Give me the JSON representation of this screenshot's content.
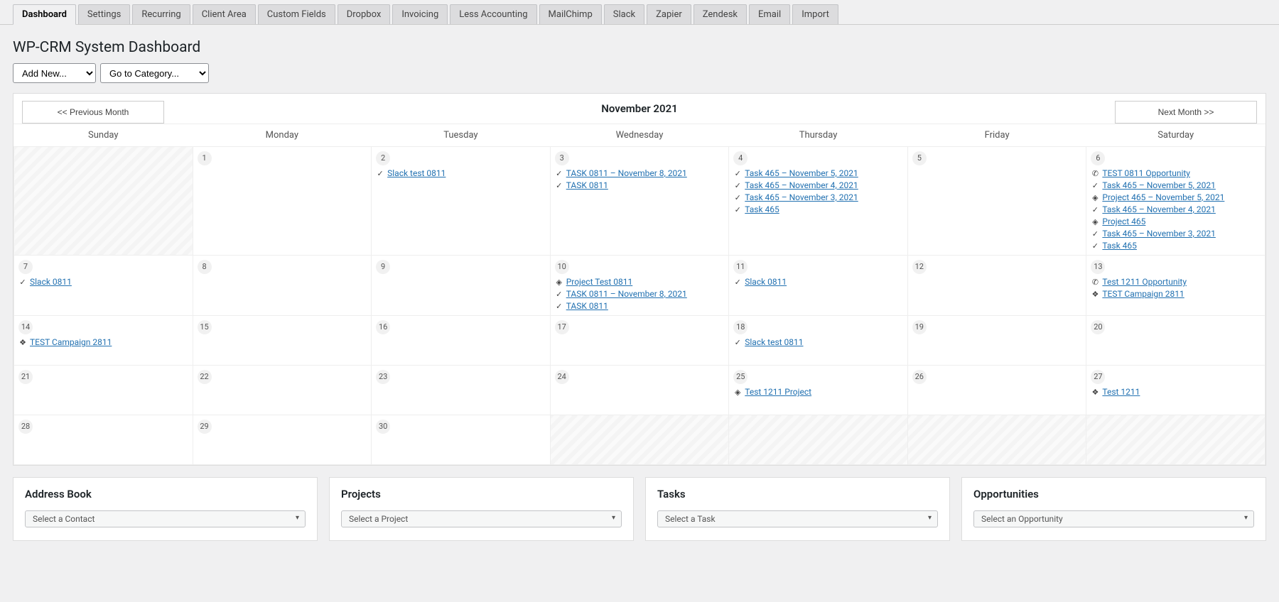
{
  "tabs": [
    "Dashboard",
    "Settings",
    "Recurring",
    "Client Area",
    "Custom Fields",
    "Dropbox",
    "Invoicing",
    "Less Accounting",
    "MailChimp",
    "Slack",
    "Zapier",
    "Zendesk",
    "Email",
    "Import"
  ],
  "active_tab_index": 0,
  "page_title": "WP-CRM System Dashboard",
  "add_new_placeholder": "Add New...",
  "go_to_category_placeholder": "Go to Category...",
  "calendar": {
    "prev_label": "<< Previous Month",
    "next_label": "Next Month >>",
    "title": "November 2021",
    "days_of_week": [
      "Sunday",
      "Monday",
      "Tuesday",
      "Wednesday",
      "Thursday",
      "Friday",
      "Saturday"
    ],
    "weeks": [
      [
        {
          "disabled": true
        },
        {
          "day": 1
        },
        {
          "day": 2,
          "events": [
            {
              "type": "task",
              "label": "Slack test 0811"
            }
          ]
        },
        {
          "day": 3,
          "events": [
            {
              "type": "task",
              "label": "TASK 0811 – November 8, 2021"
            },
            {
              "type": "task",
              "label": "TASK 0811"
            }
          ]
        },
        {
          "day": 4,
          "events": [
            {
              "type": "task",
              "label": "Task 465 – November 5, 2021"
            },
            {
              "type": "task",
              "label": "Task 465 – November 4, 2021"
            },
            {
              "type": "task",
              "label": "Task 465 – November 3, 2021"
            },
            {
              "type": "task",
              "label": "Task 465"
            }
          ]
        },
        {
          "day": 5
        },
        {
          "day": 6,
          "events": [
            {
              "type": "opportunity",
              "label": "TEST 0811 Opportunity"
            },
            {
              "type": "task",
              "label": "Task 465 – November 5, 2021"
            },
            {
              "type": "project",
              "label": "Project 465 – November 5, 2021"
            },
            {
              "type": "task",
              "label": "Task 465 – November 4, 2021"
            },
            {
              "type": "project",
              "label": "Project 465"
            },
            {
              "type": "task",
              "label": "Task 465 – November 3, 2021"
            },
            {
              "type": "task",
              "label": "Task 465"
            }
          ]
        }
      ],
      [
        {
          "day": 7,
          "events": [
            {
              "type": "task",
              "label": "Slack 0811"
            }
          ]
        },
        {
          "day": 8
        },
        {
          "day": 9
        },
        {
          "day": 10,
          "events": [
            {
              "type": "project",
              "label": "Project Test 0811"
            },
            {
              "type": "task",
              "label": "TASK 0811 – November 8, 2021"
            },
            {
              "type": "task",
              "label": "TASK 0811"
            }
          ]
        },
        {
          "day": 11,
          "events": [
            {
              "type": "task",
              "label": "Slack 0811"
            }
          ]
        },
        {
          "day": 12
        },
        {
          "day": 13,
          "events": [
            {
              "type": "opportunity",
              "label": "Test 1211 Opportunity"
            },
            {
              "type": "campaign",
              "label": "TEST Campaign 2811"
            }
          ]
        }
      ],
      [
        {
          "day": 14,
          "events": [
            {
              "type": "campaign",
              "label": "TEST Campaign 2811"
            }
          ]
        },
        {
          "day": 15
        },
        {
          "day": 16
        },
        {
          "day": 17
        },
        {
          "day": 18,
          "events": [
            {
              "type": "task",
              "label": "Slack test 0811"
            }
          ]
        },
        {
          "day": 19
        },
        {
          "day": 20
        }
      ],
      [
        {
          "day": 21
        },
        {
          "day": 22
        },
        {
          "day": 23
        },
        {
          "day": 24
        },
        {
          "day": 25,
          "events": [
            {
              "type": "project",
              "label": "Test 1211 Project"
            }
          ]
        },
        {
          "day": 26
        },
        {
          "day": 27,
          "events": [
            {
              "type": "campaign",
              "label": "Test 1211"
            }
          ]
        }
      ],
      [
        {
          "day": 28
        },
        {
          "day": 29
        },
        {
          "day": 30
        },
        {
          "disabled": true
        },
        {
          "disabled": true
        },
        {
          "disabled": true
        },
        {
          "disabled": true
        }
      ]
    ]
  },
  "boxes": {
    "address_book": {
      "title": "Address Book",
      "placeholder": "Select a Contact"
    },
    "projects": {
      "title": "Projects",
      "placeholder": "Select a Project"
    },
    "tasks": {
      "title": "Tasks",
      "placeholder": "Select a Task"
    },
    "opportunities": {
      "title": "Opportunities",
      "placeholder": "Select an Opportunity"
    }
  },
  "icons": {
    "task": "✓",
    "project": "◈",
    "opportunity": "✆",
    "campaign": "❖"
  }
}
